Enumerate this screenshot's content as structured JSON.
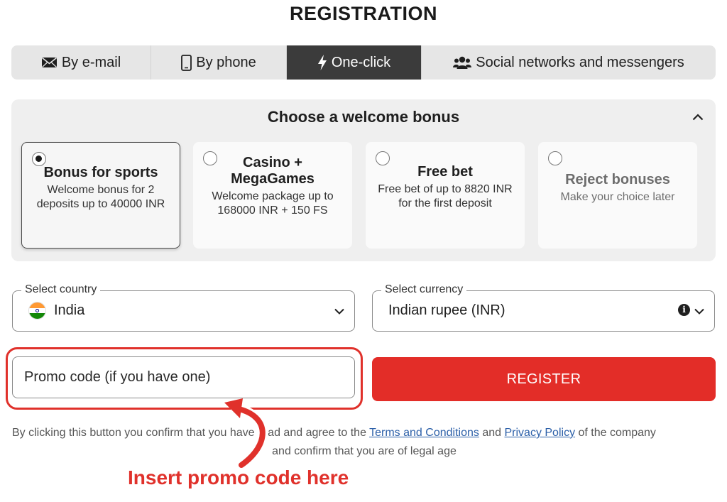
{
  "page": {
    "title": "REGISTRATION"
  },
  "tabs": [
    {
      "label": "By e-mail",
      "icon": "envelope-icon",
      "active": false
    },
    {
      "label": "By phone",
      "icon": "phone-icon",
      "active": false
    },
    {
      "label": "One-click",
      "icon": "lightning-icon",
      "active": true
    },
    {
      "label": "Social networks and messengers",
      "icon": "users-icon",
      "active": false
    }
  ],
  "bonus": {
    "heading": "Choose a welcome bonus",
    "collapse_icon": "chevron-up-icon",
    "cards": [
      {
        "title": "Bonus for sports",
        "desc": "Welcome bonus for 2 deposits up to 40000 INR",
        "selected": true
      },
      {
        "title": "Casino + MegaGames",
        "desc": "Welcome package up to 168000 INR + 150 FS",
        "selected": false
      },
      {
        "title": "Free bet",
        "desc": "Free bet of up to 8820 INR for the first deposit",
        "selected": false
      },
      {
        "title": "Reject bonuses",
        "desc": "Make your choice later",
        "selected": false
      }
    ]
  },
  "country": {
    "label": "Select country",
    "value": "India",
    "icon": "india-flag-icon"
  },
  "currency": {
    "label": "Select currency",
    "value": "Indian rupee (INR)",
    "info_icon": "info-icon"
  },
  "promo": {
    "placeholder": "Promo code (if you have one)"
  },
  "register": {
    "label": "REGISTER"
  },
  "legal": {
    "prefix": "By clicking this button you confirm that you have read and agree to the",
    "terms_link": "Terms and Conditions",
    "and": "and",
    "privacy_link": "Privacy Policy",
    "suffix": "of the company",
    "line2": "and confirm that you are of legal age"
  },
  "annotation": {
    "text": "Insert promo code here",
    "color": "#e0312b"
  },
  "colors": {
    "accent": "#e32d28",
    "active_tab": "#3b3b3b",
    "link": "#2b5fa8"
  }
}
